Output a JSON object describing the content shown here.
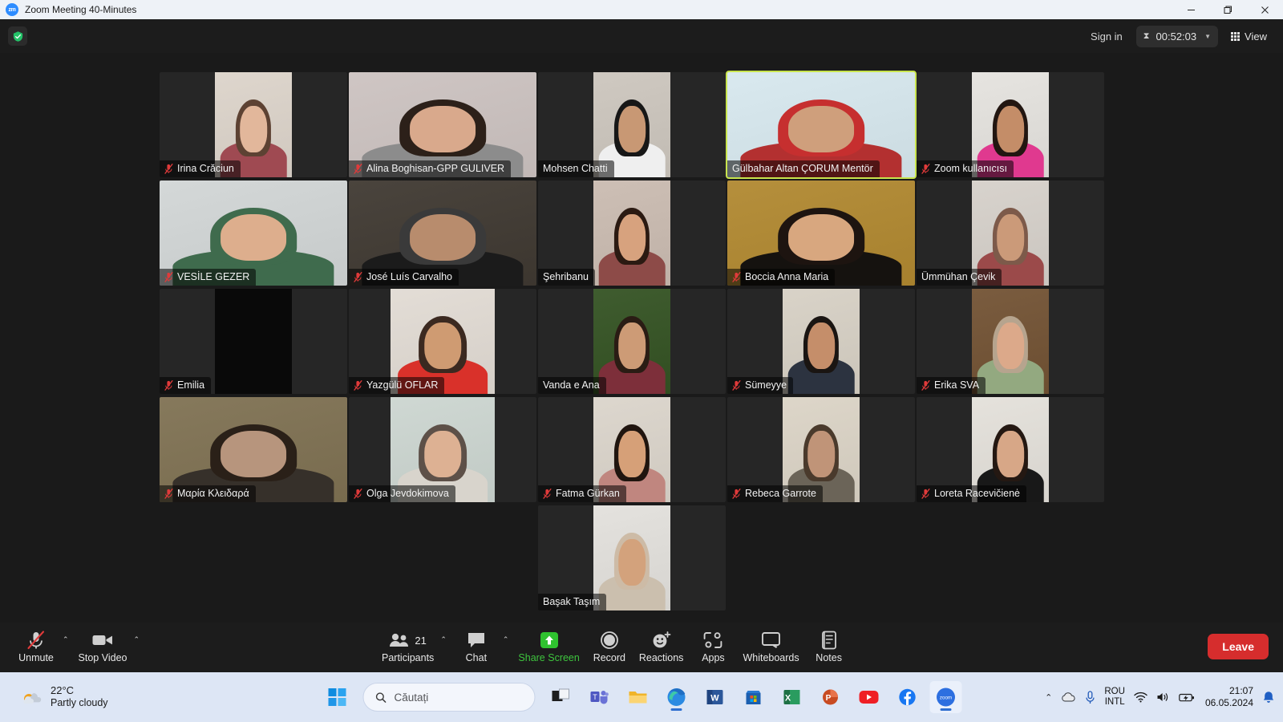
{
  "window": {
    "title": "Zoom Meeting 40-Minutes",
    "app_icon": "zoom-icon",
    "minimize": "—",
    "maximize": "❐",
    "close": "✕"
  },
  "header": {
    "encryption_icon": "shield-check-icon",
    "sign_in": "Sign in",
    "timer_icon": "hourglass-icon",
    "timer": "00:52:03",
    "timer_caret": "▼",
    "view_label": "View",
    "view_icon": "grid-icon"
  },
  "participants": [
    {
      "name": "Irina Crăciun",
      "muted": true,
      "video": "on",
      "active": false,
      "size": "narrow",
      "skin": "#e2b79b",
      "hair": "#5d4233",
      "bg": "#ded6cd",
      "shirt": "#9f4a52"
    },
    {
      "name": "Alina Boghisan-GPP GULIVER",
      "muted": true,
      "video": "on",
      "active": false,
      "size": "wide",
      "skin": "#d9a98c",
      "hair": "#2c2019",
      "bg": "#cfc6c4",
      "shirt": "#8c8c8c"
    },
    {
      "name": "Mohsen Chatti",
      "muted": false,
      "video": "on",
      "active": false,
      "size": "narrow",
      "skin": "#c89874",
      "hair": "#171717",
      "bg": "#cfc9c1",
      "shirt": "#efefef"
    },
    {
      "name": "Gülbahar Altan ÇORUM Mentör",
      "muted": false,
      "video": "on",
      "active": true,
      "size": "wide",
      "skin": "#cf9f7c",
      "hair": "#c62f2f",
      "bg": "#d9e9ef",
      "shirt": "#b33030"
    },
    {
      "name": "Zoom kullanıcısı",
      "muted": true,
      "video": "on",
      "active": false,
      "size": "narrow",
      "skin": "#c48d68",
      "hair": "#221611",
      "bg": "#e6e4e0",
      "shirt": "#e0398f"
    },
    {
      "name": "VESİLE GEZER",
      "muted": true,
      "video": "on",
      "active": false,
      "size": "wide",
      "skin": "#ddae8d",
      "hair": "#3f6b4d",
      "bg": "#d4d8d8",
      "shirt": "#3f6b4d"
    },
    {
      "name": "José Luís Carvalho",
      "muted": true,
      "video": "on",
      "active": false,
      "size": "wide",
      "skin": "#b88c6d",
      "hair": "#3a3a3a",
      "bg": "#4a443d",
      "shirt": "#1b1b1b"
    },
    {
      "name": "Şehribanu",
      "muted": false,
      "video": "on",
      "active": false,
      "size": "narrow",
      "skin": "#d7a27e",
      "hair": "#2b1a12",
      "bg": "#cdbfb5",
      "shirt": "#8d4b48"
    },
    {
      "name": "Boccia Anna Maria",
      "muted": true,
      "video": "on",
      "active": false,
      "size": "wide",
      "skin": "#d8a77f",
      "hair": "#1d1410",
      "bg": "#b58f3c",
      "shirt": "#15120f"
    },
    {
      "name": "Ümmühan Çevik",
      "muted": false,
      "video": "on",
      "active": false,
      "size": "narrow",
      "skin": "#cb9a79",
      "hair": "#7d5a4a",
      "bg": "#d8d3cd",
      "shirt": "#9b4a4a"
    },
    {
      "name": "Emilia",
      "muted": true,
      "video": "off",
      "active": false,
      "size": "narrow",
      "skin": "#000000",
      "hair": "#000000",
      "bg": "#090909",
      "shirt": "#0a0a0a"
    },
    {
      "name": "Yazgülü OFLAR",
      "muted": true,
      "video": "on",
      "active": false,
      "size": "mid",
      "skin": "#cf9b72",
      "hair": "#3b2920",
      "bg": "#e3ddd6",
      "shirt": "#d9312a"
    },
    {
      "name": "Vanda e Ana",
      "muted": false,
      "video": "on",
      "active": false,
      "size": "narrow",
      "skin": "#cd9b76",
      "hair": "#2a1c14",
      "bg": "#3f5c2f",
      "shirt": "#7d2f3a"
    },
    {
      "name": "Sümeyye",
      "muted": true,
      "video": "on",
      "active": false,
      "size": "narrow",
      "skin": "#c58e6a",
      "hair": "#1a1512",
      "bg": "#d9d3c8",
      "shirt": "#2c3340"
    },
    {
      "name": "Erika SVA",
      "muted": true,
      "video": "on",
      "active": false,
      "size": "narrow",
      "skin": "#dca98a",
      "hair": "#b6a48e",
      "bg": "#7a5c3f",
      "shirt": "#93a980"
    },
    {
      "name": "Μαρία Κλειδαρά",
      "muted": true,
      "video": "on",
      "active": false,
      "size": "wide",
      "skin": "#b7957d",
      "hair": "#2a2018",
      "bg": "#86795c",
      "shirt": "#36302a"
    },
    {
      "name": "Olga Jevdokimova",
      "muted": true,
      "video": "on",
      "active": false,
      "size": "mid",
      "skin": "#ddb193",
      "hair": "#5d5048",
      "bg": "#cfd8d3",
      "shirt": "#d8d4cc"
    },
    {
      "name": "Fatma Gürkan",
      "muted": true,
      "video": "on",
      "active": false,
      "size": "narrow",
      "skin": "#d6a078",
      "hair": "#20150f",
      "bg": "#ddd7ce",
      "shirt": "#c0867f"
    },
    {
      "name": "Rebeca Garrote",
      "muted": true,
      "video": "on",
      "active": false,
      "size": "narrow",
      "skin": "#c09478",
      "hair": "#4a3a2c",
      "bg": "#ddd6c9",
      "shirt": "#6b6458"
    },
    {
      "name": "Loreta Racevičienė",
      "muted": true,
      "video": "on",
      "active": false,
      "size": "narrow",
      "skin": "#d7a787",
      "hair": "#241812",
      "bg": "#e5e2dc",
      "shirt": "#181818"
    },
    {
      "name": "Başak Taşım",
      "muted": false,
      "video": "on",
      "active": false,
      "size": "narrow",
      "skin": "#d3a27c",
      "hair": "#cdbba6",
      "bg": "#e4e2de",
      "shirt": "#cbbfae"
    }
  ],
  "toolbar": {
    "left": [
      {
        "label": "Unmute",
        "icon": "microphone-muted-icon",
        "caret": "⌃",
        "green": false
      },
      {
        "label": "Stop Video",
        "icon": "video-camera-icon",
        "caret": "⌃",
        "green": false
      }
    ],
    "center": [
      {
        "label": "Participants",
        "icon": "people-icon",
        "caret": "⌃",
        "badge": "21",
        "green": false
      },
      {
        "label": "Chat",
        "icon": "chat-bubble-icon",
        "caret": "⌃",
        "badge": "",
        "green": false
      },
      {
        "label": "Share Screen",
        "icon": "share-screen-icon",
        "caret": "",
        "badge": "",
        "green": true
      },
      {
        "label": "Record",
        "icon": "record-icon",
        "caret": "",
        "badge": "",
        "green": false
      },
      {
        "label": "Reactions",
        "icon": "reactions-icon",
        "caret": "",
        "badge": "",
        "green": false
      },
      {
        "label": "Apps",
        "icon": "apps-icon",
        "caret": "",
        "badge": "",
        "green": false
      },
      {
        "label": "Whiteboards",
        "icon": "whiteboard-icon",
        "caret": "",
        "badge": "",
        "green": false
      },
      {
        "label": "Notes",
        "icon": "notes-icon",
        "caret": "",
        "badge": "",
        "green": false
      }
    ],
    "leave_label": "Leave",
    "leave_color": "#d62d2d",
    "share_color": "#3ec43e"
  },
  "taskbar": {
    "weather": {
      "icon": "partly-cloudy-icon",
      "temperature": "22°C",
      "condition": "Partly cloudy"
    },
    "start_icon": "windows-start-icon",
    "search": {
      "icon": "search-icon",
      "placeholder": "Căutați",
      "value": ""
    },
    "apps": [
      {
        "name": "task-view-icon",
        "open": false
      },
      {
        "name": "teams-icon",
        "open": false
      },
      {
        "name": "file-explorer-icon",
        "open": false
      },
      {
        "name": "edge-icon",
        "open": false
      },
      {
        "name": "word-icon",
        "open": false
      },
      {
        "name": "microsoft-store-icon",
        "open": false
      },
      {
        "name": "excel-icon",
        "open": false
      },
      {
        "name": "powerpoint-icon",
        "open": false
      },
      {
        "name": "youtube-icon",
        "open": false
      },
      {
        "name": "facebook-icon",
        "open": false
      },
      {
        "name": "zoom-taskbar-icon",
        "open": true
      }
    ],
    "tray": {
      "chevron": "⌃",
      "onedrive_icon": "cloud-icon",
      "mic_icon": "microphone-icon",
      "language_line1": "ROU",
      "language_line2": "INTL",
      "wifi_icon": "wifi-icon",
      "volume_icon": "speaker-icon",
      "battery_icon": "battery-icon",
      "time": "21:07",
      "date": "06.05.2024",
      "notification_icon": "bell-icon"
    }
  }
}
